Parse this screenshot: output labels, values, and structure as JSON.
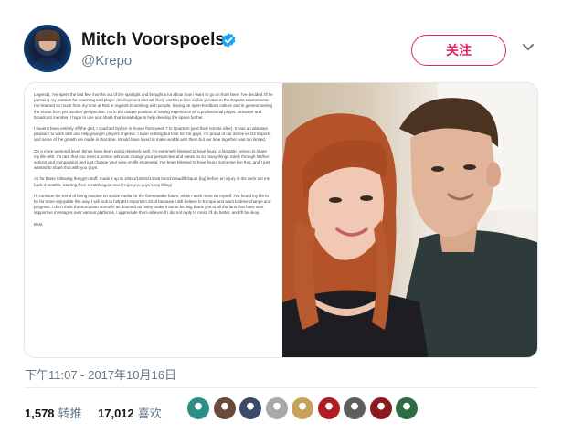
{
  "header": {
    "display_name": "Mitch Voorspoels",
    "handle": "@Krepo",
    "follow_label": "关注"
  },
  "notes": {
    "paragraphs": [
      "Legends, I've spent the last few months out of the spotlight and thought a lot about how I want to go on from here. I've decided I'll be pursuing my passion for coaching and player development and will likely work in a less visible position in the Esports environment. I've learned so much from my time at Riot in regards to working with people, having an open-feedback culture and in general seeing the scene from yet another perspective. I'm in the unique position of having experience as a professional player, streamer and broadcast member. I hope to use and share that knowledge to help develop the space further.",
      "I haven't been entirely off the grid, I coached Splyce in-house from week 7 to Quarters (and then remote after). It was an absolute pleasure to work with and help younger players improve. I have nothing but love for the guys. I'm proud of our series vs G2 Esports and some of the growth we made in that time. Would have loved to make worlds with them but our time together was too limited.",
      "On a more personal level, things have been going relatively well. I'm extremely blessed to have found a fantastic person to share my life with. It's rare that you meet a person who can change your perspective and views on so many things solely through his/her actions and compassion and just change your view on life in general. I've been blessed to have found someone like that, and I just wanted to share that with you guys.",
      "As for those following the gym stuff, made it up to 105x1/150x5/140x5 bench/deadlift/squat (kg) before an injury in the neck set me back 3 months. Starting from scratch again now! Hope you guys keep lifting!",
      "I'll continue the trend of being inactive on social media for the foreseeable future, while I work more on myself. I've found my life to be far more enjoyable this way. I will look to help EU esports in 2018 because I still believe in Europe and want to drive change and progress. I don't think the European scene is as doomed as many make it out to be. Big thank you to all the fans that have sent supportive messages over various platforms, I appreciate them all even if I did not reply to most. I'll do better, and I'll be okay."
    ],
    "sign_off": "Best,"
  },
  "timestamp": "下午11:07 - 2017年10月16日",
  "stats": {
    "retweets_count": "1,578",
    "retweets_label": "转推",
    "likes_count": "17,012",
    "likes_label": "喜欢"
  },
  "likers": [
    {
      "color": "#2a8f86"
    },
    {
      "color": "#6b4a3a"
    },
    {
      "color": "#3b4a6b"
    },
    {
      "color": "#a8a8a8"
    },
    {
      "color": "#c7a05a"
    },
    {
      "color": "#b01e23"
    },
    {
      "color": "#5e5e5e"
    },
    {
      "color": "#8a1a22"
    },
    {
      "color": "#2f6c43"
    }
  ]
}
